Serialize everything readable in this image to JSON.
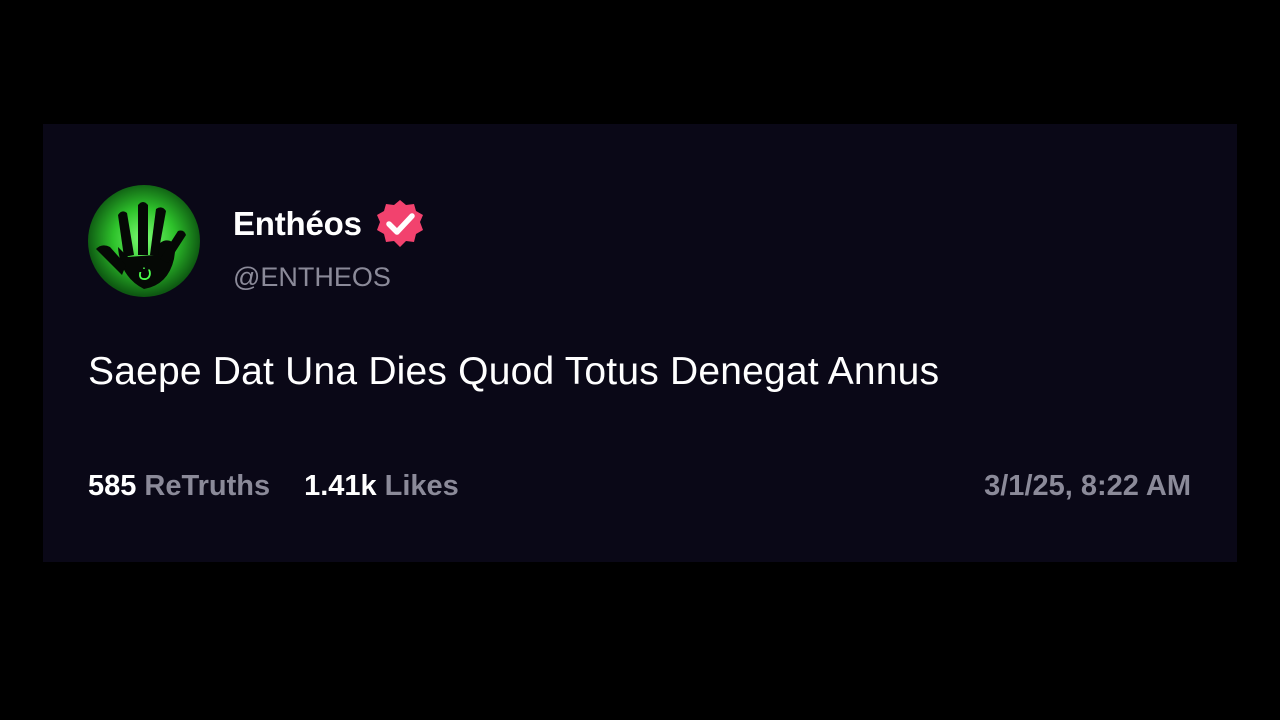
{
  "post": {
    "author": {
      "display_name": "Enthéos",
      "handle": "@ENTHEOS",
      "verified": true,
      "avatar_icon": "green-glowing-hand-avatar",
      "avatar_symbol": "ن"
    },
    "text": "Saepe Dat Una Dies Quod Totus Denegat Annus",
    "stats": {
      "retruths_count": "585",
      "retruths_label": "ReTruths",
      "likes_count": "1.41k",
      "likes_label": "Likes"
    },
    "timestamp": "3/1/25, 8:22 AM"
  },
  "colors": {
    "page_background": "#000000",
    "card_background": "#0a0817",
    "primary_text": "#ffffff",
    "secondary_text": "#8b8a99",
    "verified_badge": "#f2426e",
    "avatar_glow": "#2ec22b"
  }
}
